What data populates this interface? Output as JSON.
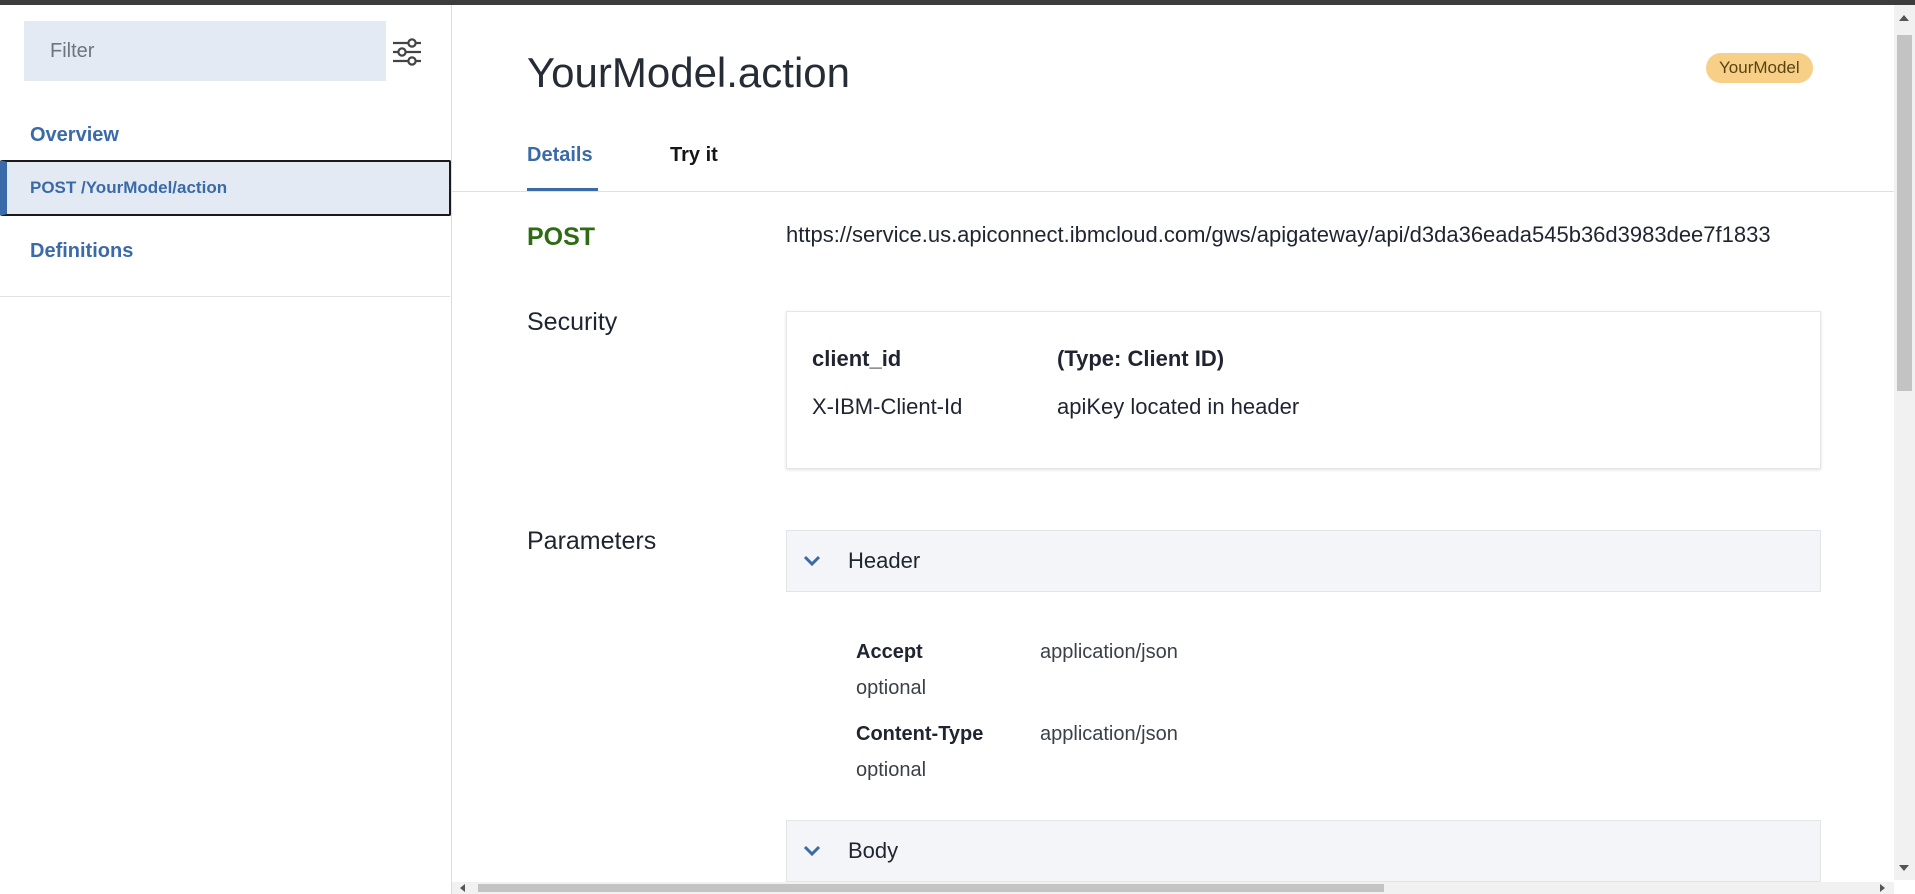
{
  "sidebar": {
    "filter_placeholder": "Filter",
    "filter_icon": "sliders-icon",
    "items": [
      {
        "label": "Overview"
      },
      {
        "label": "POST /YourModel/action",
        "selected": true
      },
      {
        "label": "Definitions"
      }
    ]
  },
  "main": {
    "title": "YourModel.action",
    "tag": "YourModel",
    "tabs": [
      {
        "label": "Details",
        "active": true
      },
      {
        "label": "Try it"
      }
    ],
    "method": "POST",
    "url": "https://service.us.apiconnect.ibmcloud.com/gws/apigateway/api/d3da36eada545b36d3983dee7f1833",
    "security": {
      "label": "Security",
      "name": "client_id",
      "type": "(Type: Client ID)",
      "key": "X-IBM-Client-Id",
      "description": "apiKey located in header"
    },
    "parameters": {
      "label": "Parameters",
      "header_section": "Header",
      "body_section": "Body",
      "headers": [
        {
          "name": "Accept",
          "required": "optional",
          "value": "application/json"
        },
        {
          "name": "Content-Type",
          "required": "optional",
          "value": "application/json"
        }
      ]
    }
  },
  "colors": {
    "accent": "#3b6aa8",
    "post_method": "#2e6b12",
    "tag_bg": "#f7cf86",
    "sidebar_selected_bg": "#e4eaf3"
  }
}
